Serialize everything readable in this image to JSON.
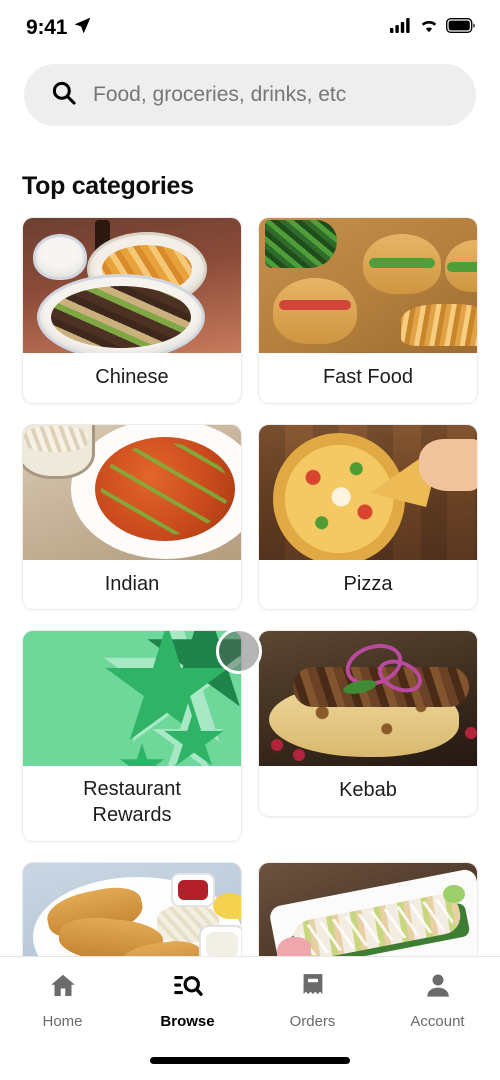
{
  "status_bar": {
    "time": "9:41",
    "location_icon": "location-arrow-icon",
    "cellular_icon": "cellular-signal-icon",
    "wifi_icon": "wifi-icon",
    "battery_icon": "battery-full-icon"
  },
  "search": {
    "placeholder": "Food, groceries, drinks, etc",
    "value": "",
    "icon": "search-icon"
  },
  "main": {
    "section_title": "Top categories",
    "categories": [
      {
        "label": "Chinese",
        "art": "chi",
        "kind": "photo"
      },
      {
        "label": "Fast Food",
        "art": "ff",
        "kind": "photo"
      },
      {
        "label": "Indian",
        "art": "ind",
        "kind": "photo"
      },
      {
        "label": "Pizza",
        "art": "piz",
        "kind": "photo"
      },
      {
        "label": "Restaurant Rewards",
        "art": "rew",
        "kind": "promo"
      },
      {
        "label": "Kebab",
        "art": "keb",
        "kind": "photo"
      },
      {
        "label": "",
        "art": "fish",
        "kind": "photo"
      },
      {
        "label": "",
        "art": "sus",
        "kind": "photo"
      }
    ]
  },
  "cursor": {
    "name": "touch-pointer"
  },
  "tabbar": {
    "items": [
      {
        "label": "Home",
        "icon": "home-icon",
        "active": false
      },
      {
        "label": "Browse",
        "icon": "browse-search-icon",
        "active": true
      },
      {
        "label": "Orders",
        "icon": "receipt-icon",
        "active": false
      },
      {
        "label": "Account",
        "icon": "person-icon",
        "active": false
      }
    ]
  },
  "colors": {
    "accent_green": "#6ed79a",
    "star_dark": "#1e8449",
    "star_mid": "#2eb367",
    "star_light": "#a9e8c4",
    "search_bg": "#eeeeee",
    "inactive_gray": "#6b6b6b",
    "active_black": "#000000"
  }
}
